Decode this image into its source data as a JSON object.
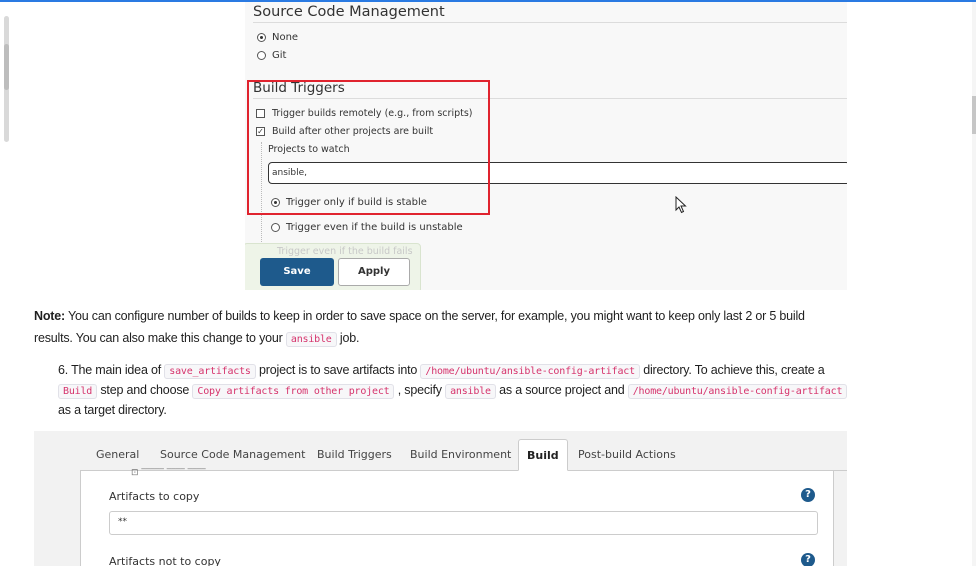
{
  "scm": {
    "title": "Source Code Management",
    "options": [
      {
        "label": "None",
        "selected": true
      },
      {
        "label": "Git",
        "selected": false
      }
    ]
  },
  "build_triggers": {
    "title": "Build Triggers",
    "trigger_remote_label": "Trigger builds remotely (e.g., from scripts)",
    "trigger_remote_checked": false,
    "build_after_label": "Build after other projects are built",
    "build_after_checked": true,
    "projects_to_watch_label": "Projects to watch",
    "projects_to_watch_value": "ansible,",
    "radio_stable": "Trigger only if build is stable",
    "radio_unstable": "Trigger even if the build is unstable",
    "radio_fails": "Trigger even if the build fails",
    "selected_radio": "stable"
  },
  "buttons": {
    "save": "Save",
    "apply": "Apply"
  },
  "note": {
    "label": "Note:",
    "text1": " You can configure number of builds to keep in order to save space on the server, for example, you might want to keep only last 2 or 5 build results. You can also make this change to your ",
    "code1": "ansible",
    "text2": " job."
  },
  "step": {
    "number": "6.",
    "t1": " The main idea of ",
    "c1": "save_artifacts",
    "t2": " project is to save artifacts into ",
    "c2": "/home/ubuntu/ansible-config-artifact",
    "t3": " directory. To achieve this, create a ",
    "c3": "Build",
    "t4": " step and choose ",
    "c4": "Copy artifacts from other project",
    "t5": " , specify ",
    "c5": "ansible",
    "t6": " as a source project and ",
    "c6": "/home/ubuntu/ansible-config-artifact",
    "t7": " as a target directory."
  },
  "job_tabs": {
    "items": [
      "General",
      "Source Code Management",
      "Build Triggers",
      "Build Environment",
      "Build",
      "Post-build Actions"
    ],
    "active": "Build"
  },
  "build_panel": {
    "artifacts_to_copy_label": "Artifacts to copy",
    "artifacts_to_copy_value": "**",
    "artifacts_not_to_copy_label": "Artifacts not to copy",
    "help_icon": "?"
  }
}
